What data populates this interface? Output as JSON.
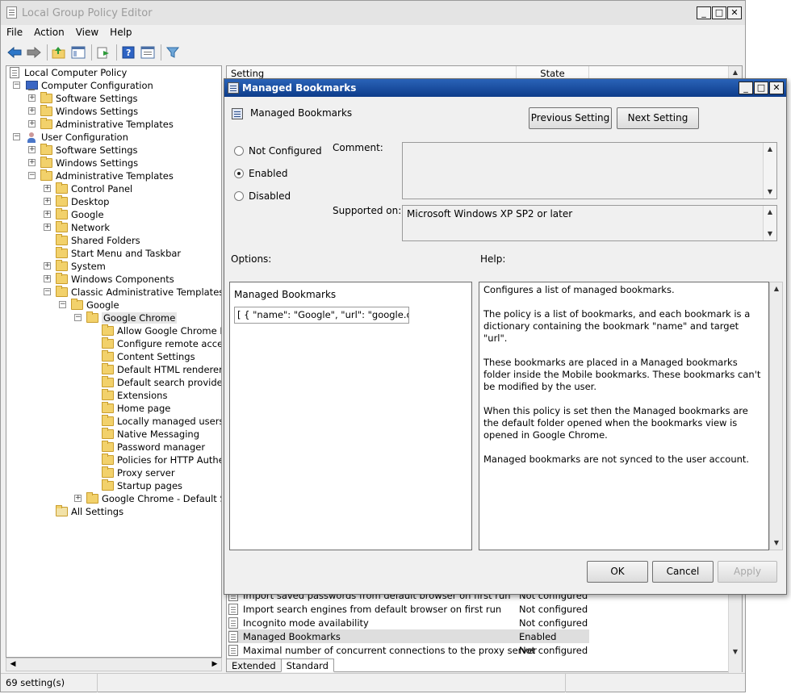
{
  "main_window": {
    "title": "Local Group Policy Editor",
    "caption_buttons": {
      "minimize": "_",
      "maximize": "□",
      "close": "✕"
    }
  },
  "menu": [
    "File",
    "Action",
    "View",
    "Help"
  ],
  "toolbar_icons": [
    "back-icon",
    "forward-icon",
    "up-folder-icon",
    "show-hide-tree-icon",
    "export-list-icon",
    "help-icon",
    "properties-icon",
    "filter-icon"
  ],
  "tree": {
    "root": "Local Computer Policy",
    "computer_config": "Computer Configuration",
    "cc_software": "Software Settings",
    "cc_windows": "Windows Settings",
    "cc_admin": "Administrative Templates",
    "user_config": "User Configuration",
    "uc_software": "Software Settings",
    "uc_windows": "Windows Settings",
    "uc_admin": "Administrative Templates",
    "control_panel": "Control Panel",
    "desktop": "Desktop",
    "google": "Google",
    "network": "Network",
    "shared_folders": "Shared Folders",
    "start_menu": "Start Menu and Taskbar",
    "system": "System",
    "windows_components": "Windows Components",
    "classic_admin": "Classic Administrative Templates (ADM)",
    "classic_google": "Google",
    "google_chrome": "Google Chrome",
    "chrome_children": [
      "Allow Google Chrome Frame",
      "Configure remote access o",
      "Content Settings",
      "Default HTML renderer for",
      "Default search provider",
      "Extensions",
      "Home page",
      "Locally managed users set",
      "Native Messaging",
      "Password manager",
      "Policies for HTTP Authenti",
      "Proxy server",
      "Startup pages"
    ],
    "chrome_default": "Google Chrome - Default Settin",
    "all_settings": "All Settings"
  },
  "list": {
    "col_setting": "Setting",
    "col_state": "State",
    "rows": [
      {
        "setting": "Import saved passwords from default browser on first run",
        "state": "Not configured"
      },
      {
        "setting": "Import search engines from default browser on first run",
        "state": "Not configured"
      },
      {
        "setting": "Incognito mode availability",
        "state": "Not configured"
      },
      {
        "setting": "Managed Bookmarks",
        "state": "Enabled"
      },
      {
        "setting": "Maximal number of concurrent connections to the proxy server",
        "state": "Not configured"
      }
    ]
  },
  "tabs": {
    "extended": "Extended",
    "standard": "Standard"
  },
  "status": {
    "text": "69 setting(s)"
  },
  "dialog": {
    "title": "Managed Bookmarks",
    "setting_name": "Managed Bookmarks",
    "prev_button": "Previous Setting",
    "next_button": "Next Setting",
    "radio_not_configured": "Not Configured",
    "radio_enabled": "Enabled",
    "radio_disabled": "Disabled",
    "selected_option": "Enabled",
    "comment_label": "Comment:",
    "comment_value": "",
    "supported_label": "Supported on:",
    "supported_value": "Microsoft Windows XP SP2 or later",
    "options_label": "Options:",
    "help_label": "Help:",
    "option_field_label": "Managed Bookmarks",
    "option_field_value": "[ { \"name\": \"Google\", \"url\": \"google.com",
    "help_paragraphs": [
      "Configures a list of managed bookmarks.",
      "The policy is a list of bookmarks, and each bookmark is a dictionary containing the bookmark \"name\" and target \"url\".",
      "These bookmarks are placed in a Managed bookmarks folder inside the Mobile bookmarks. These bookmarks can't be modified by the user.",
      "When this policy is set then the Managed bookmarks are the default folder opened when the bookmarks view is opened in Google Chrome.",
      "Managed bookmarks are not synced to the user account."
    ],
    "ok": "OK",
    "cancel": "Cancel",
    "apply": "Apply"
  }
}
